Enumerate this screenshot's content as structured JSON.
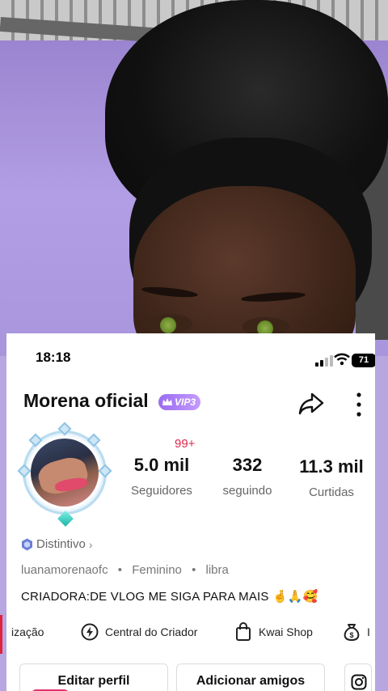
{
  "status_bar": {
    "time": "18:18",
    "battery": "71"
  },
  "profile": {
    "name": "Morena oficial",
    "vip_badge": "VIP3",
    "notification_badge": "99+",
    "stats": [
      {
        "value": "5.0 mil",
        "label": "Seguidores"
      },
      {
        "value": "332",
        "label": "seguindo"
      },
      {
        "value": "11.3 mil",
        "label": "Curtidas"
      }
    ],
    "distintivo": "Distintivo",
    "username": "luanamorenaofc",
    "gender": "Feminino",
    "sign": "libra",
    "bio": "CRIADORA:DE VLOG ME SIGA PARA MAIS 🤞🙏🥰"
  },
  "toolbar": {
    "item_cut": "ização",
    "creator_center": "Central do Criador",
    "kwai_shop": "Kwai Shop"
  },
  "buttons": {
    "edit_profile": "Editar perfil",
    "add_friends": "Adicionar amigos"
  },
  "colors": {
    "accent_red": "#e2264d",
    "vip_purple": "#9a6cf0",
    "shield_blue": "#6b7fd6"
  },
  "icons": [
    "share-icon",
    "more-icon",
    "shield-icon",
    "lightning-icon",
    "bag-icon",
    "money-bag-icon",
    "instagram-icon",
    "signal-icon",
    "wifi-icon",
    "battery-icon"
  ]
}
